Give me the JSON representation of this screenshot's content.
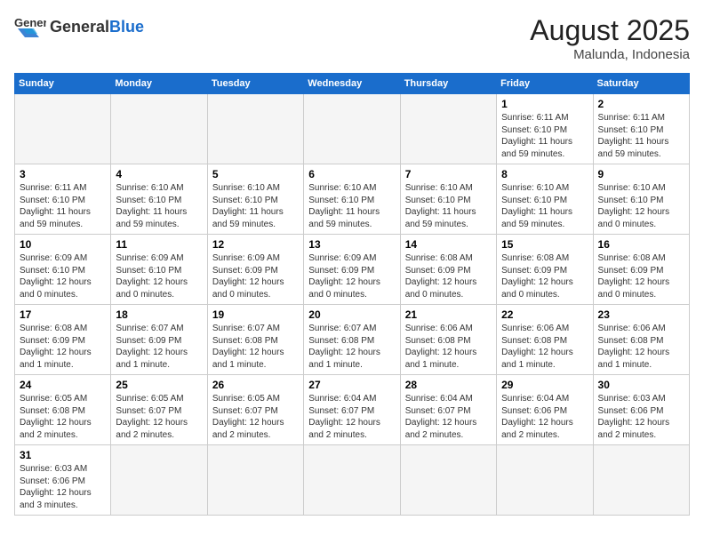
{
  "header": {
    "logo_general": "General",
    "logo_blue": "Blue",
    "month_year": "August 2025",
    "location": "Malunda, Indonesia"
  },
  "weekdays": [
    "Sunday",
    "Monday",
    "Tuesday",
    "Wednesday",
    "Thursday",
    "Friday",
    "Saturday"
  ],
  "weeks": [
    [
      {
        "day": "",
        "info": "",
        "empty": true
      },
      {
        "day": "",
        "info": "",
        "empty": true
      },
      {
        "day": "",
        "info": "",
        "empty": true
      },
      {
        "day": "",
        "info": "",
        "empty": true
      },
      {
        "day": "",
        "info": "",
        "empty": true
      },
      {
        "day": "1",
        "info": "Sunrise: 6:11 AM\nSunset: 6:10 PM\nDaylight: 11 hours and 59 minutes.",
        "empty": false
      },
      {
        "day": "2",
        "info": "Sunrise: 6:11 AM\nSunset: 6:10 PM\nDaylight: 11 hours and 59 minutes.",
        "empty": false
      }
    ],
    [
      {
        "day": "3",
        "info": "Sunrise: 6:11 AM\nSunset: 6:10 PM\nDaylight: 11 hours and 59 minutes.",
        "empty": false
      },
      {
        "day": "4",
        "info": "Sunrise: 6:10 AM\nSunset: 6:10 PM\nDaylight: 11 hours and 59 minutes.",
        "empty": false
      },
      {
        "day": "5",
        "info": "Sunrise: 6:10 AM\nSunset: 6:10 PM\nDaylight: 11 hours and 59 minutes.",
        "empty": false
      },
      {
        "day": "6",
        "info": "Sunrise: 6:10 AM\nSunset: 6:10 PM\nDaylight: 11 hours and 59 minutes.",
        "empty": false
      },
      {
        "day": "7",
        "info": "Sunrise: 6:10 AM\nSunset: 6:10 PM\nDaylight: 11 hours and 59 minutes.",
        "empty": false
      },
      {
        "day": "8",
        "info": "Sunrise: 6:10 AM\nSunset: 6:10 PM\nDaylight: 11 hours and 59 minutes.",
        "empty": false
      },
      {
        "day": "9",
        "info": "Sunrise: 6:10 AM\nSunset: 6:10 PM\nDaylight: 12 hours and 0 minutes.",
        "empty": false
      }
    ],
    [
      {
        "day": "10",
        "info": "Sunrise: 6:09 AM\nSunset: 6:10 PM\nDaylight: 12 hours and 0 minutes.",
        "empty": false
      },
      {
        "day": "11",
        "info": "Sunrise: 6:09 AM\nSunset: 6:10 PM\nDaylight: 12 hours and 0 minutes.",
        "empty": false
      },
      {
        "day": "12",
        "info": "Sunrise: 6:09 AM\nSunset: 6:09 PM\nDaylight: 12 hours and 0 minutes.",
        "empty": false
      },
      {
        "day": "13",
        "info": "Sunrise: 6:09 AM\nSunset: 6:09 PM\nDaylight: 12 hours and 0 minutes.",
        "empty": false
      },
      {
        "day": "14",
        "info": "Sunrise: 6:08 AM\nSunset: 6:09 PM\nDaylight: 12 hours and 0 minutes.",
        "empty": false
      },
      {
        "day": "15",
        "info": "Sunrise: 6:08 AM\nSunset: 6:09 PM\nDaylight: 12 hours and 0 minutes.",
        "empty": false
      },
      {
        "day": "16",
        "info": "Sunrise: 6:08 AM\nSunset: 6:09 PM\nDaylight: 12 hours and 0 minutes.",
        "empty": false
      }
    ],
    [
      {
        "day": "17",
        "info": "Sunrise: 6:08 AM\nSunset: 6:09 PM\nDaylight: 12 hours and 1 minute.",
        "empty": false
      },
      {
        "day": "18",
        "info": "Sunrise: 6:07 AM\nSunset: 6:09 PM\nDaylight: 12 hours and 1 minute.",
        "empty": false
      },
      {
        "day": "19",
        "info": "Sunrise: 6:07 AM\nSunset: 6:08 PM\nDaylight: 12 hours and 1 minute.",
        "empty": false
      },
      {
        "day": "20",
        "info": "Sunrise: 6:07 AM\nSunset: 6:08 PM\nDaylight: 12 hours and 1 minute.",
        "empty": false
      },
      {
        "day": "21",
        "info": "Sunrise: 6:06 AM\nSunset: 6:08 PM\nDaylight: 12 hours and 1 minute.",
        "empty": false
      },
      {
        "day": "22",
        "info": "Sunrise: 6:06 AM\nSunset: 6:08 PM\nDaylight: 12 hours and 1 minute.",
        "empty": false
      },
      {
        "day": "23",
        "info": "Sunrise: 6:06 AM\nSunset: 6:08 PM\nDaylight: 12 hours and 1 minute.",
        "empty": false
      }
    ],
    [
      {
        "day": "24",
        "info": "Sunrise: 6:05 AM\nSunset: 6:08 PM\nDaylight: 12 hours and 2 minutes.",
        "empty": false
      },
      {
        "day": "25",
        "info": "Sunrise: 6:05 AM\nSunset: 6:07 PM\nDaylight: 12 hours and 2 minutes.",
        "empty": false
      },
      {
        "day": "26",
        "info": "Sunrise: 6:05 AM\nSunset: 6:07 PM\nDaylight: 12 hours and 2 minutes.",
        "empty": false
      },
      {
        "day": "27",
        "info": "Sunrise: 6:04 AM\nSunset: 6:07 PM\nDaylight: 12 hours and 2 minutes.",
        "empty": false
      },
      {
        "day": "28",
        "info": "Sunrise: 6:04 AM\nSunset: 6:07 PM\nDaylight: 12 hours and 2 minutes.",
        "empty": false
      },
      {
        "day": "29",
        "info": "Sunrise: 6:04 AM\nSunset: 6:06 PM\nDaylight: 12 hours and 2 minutes.",
        "empty": false
      },
      {
        "day": "30",
        "info": "Sunrise: 6:03 AM\nSunset: 6:06 PM\nDaylight: 12 hours and 2 minutes.",
        "empty": false
      }
    ],
    [
      {
        "day": "31",
        "info": "Sunrise: 6:03 AM\nSunset: 6:06 PM\nDaylight: 12 hours and 3 minutes.",
        "empty": false
      },
      {
        "day": "",
        "info": "",
        "empty": true
      },
      {
        "day": "",
        "info": "",
        "empty": true
      },
      {
        "day": "",
        "info": "",
        "empty": true
      },
      {
        "day": "",
        "info": "",
        "empty": true
      },
      {
        "day": "",
        "info": "",
        "empty": true
      },
      {
        "day": "",
        "info": "",
        "empty": true
      }
    ]
  ]
}
